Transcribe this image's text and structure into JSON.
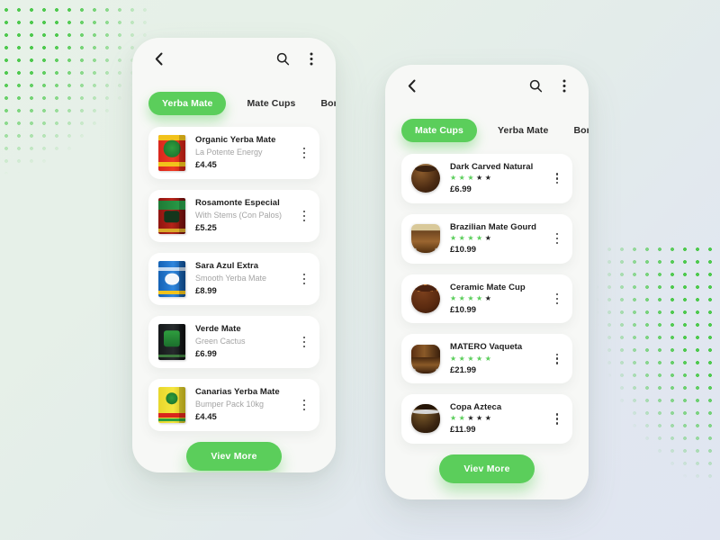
{
  "phones": [
    {
      "id": "yerba-mate-screen",
      "appbar": {
        "back_icon": "chevron-left-icon",
        "search_icon": "search-icon",
        "more_icon": "more-vertical-icon"
      },
      "tabs": [
        {
          "label": "Yerba Mate",
          "active": true
        },
        {
          "label": "Mate Cups",
          "active": false
        },
        {
          "label": "Bombill",
          "active": false
        }
      ],
      "products": [
        {
          "name": "Organic Yerba Mate",
          "subtitle": "La Potente Energy",
          "price": "£4.45",
          "thumb": "pack-red"
        },
        {
          "name": "Rosamonte Especial",
          "subtitle": "With Stems (Con Palos)",
          "price": "£5.25",
          "thumb": "pack-darkred"
        },
        {
          "name": "Sara Azul Extra",
          "subtitle": "Smooth Yerba Mate",
          "price": "£8.99",
          "thumb": "pack-blue"
        },
        {
          "name": "Verde Mate",
          "subtitle": "Green Cactus",
          "price": "£6.99",
          "thumb": "pack-black"
        },
        {
          "name": "Canarias Yerba Mate",
          "subtitle": "Bumper Pack 10kg",
          "price": "£4.45",
          "thumb": "pack-yellow"
        }
      ],
      "view_more_label": "Viev More"
    },
    {
      "id": "mate-cups-screen",
      "appbar": {
        "back_icon": "chevron-left-icon",
        "search_icon": "search-icon",
        "more_icon": "more-vertical-icon"
      },
      "tabs": [
        {
          "label": "Mate Cups",
          "active": true
        },
        {
          "label": "Yerba Mate",
          "active": false
        },
        {
          "label": "Bombil",
          "active": false
        }
      ],
      "products": [
        {
          "name": "Dark Carved Natural",
          "rating": 3,
          "max_rating": 5,
          "price": "£6.99",
          "thumb": "gourd-dark"
        },
        {
          "name": "Brazilian Mate Gourd",
          "rating": 4,
          "max_rating": 5,
          "price": "£10.99",
          "thumb": "gourd-cream"
        },
        {
          "name": "Ceramic Mate Cup",
          "rating": 4,
          "max_rating": 5,
          "price": "£10.99",
          "thumb": "gourd-ceramic"
        },
        {
          "name": "MATERO Vaqueta",
          "rating": 5,
          "max_rating": 5,
          "price": "£21.99",
          "thumb": "gourd-matero"
        },
        {
          "name": "Copa Azteca",
          "rating": 2,
          "max_rating": 5,
          "price": "£11.99",
          "thumb": "gourd-azteca"
        }
      ],
      "view_more_label": "Viev More"
    }
  ],
  "colors": {
    "accent_green": "#5bce5b",
    "dot_green": "#4ec94e",
    "card_white": "#ffffff",
    "phone_bg": "#f7f8f6",
    "text_dark": "#1d1d1d",
    "text_muted": "#a4a4a4",
    "bg_mint": "#e7f1e8",
    "bg_lavender": "#e0e5f1"
  },
  "decorations": [
    {
      "name": "dot-pattern-top-left"
    },
    {
      "name": "dot-pattern-bottom-right"
    }
  ]
}
